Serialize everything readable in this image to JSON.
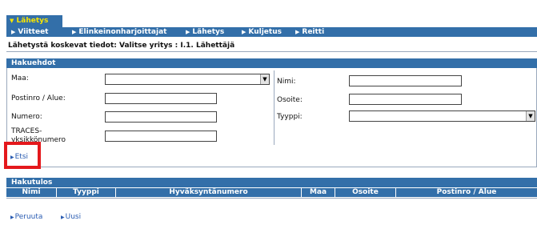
{
  "tabs": {
    "active_label": "Lähetys"
  },
  "nav": {
    "items": [
      {
        "label": "Viitteet"
      },
      {
        "label": "Elinkeinonharjoittajat"
      },
      {
        "label": "Lähetys"
      },
      {
        "label": "Kuljetus"
      },
      {
        "label": "Reitti"
      }
    ]
  },
  "breadcrumb": "Lähetystä koskevat tiedot: Valitse yritys : I.1. Lähettäjä",
  "search": {
    "header": "Hakuehdot",
    "left": {
      "maa_label": "Maa:",
      "maa_value": "",
      "postinro_label": "Postinro / Alue:",
      "postinro_value": "",
      "numero_label": "Numero:",
      "numero_value": "",
      "traces_label": "TRACES-yksikkönumero",
      "traces_value": ""
    },
    "right": {
      "nimi_label": "Nimi:",
      "nimi_value": "",
      "osoite_label": "Osoite:",
      "osoite_value": "",
      "tyyppi_label": "Tyyppi:",
      "tyyppi_value": ""
    },
    "etsi_label": "Etsi"
  },
  "results": {
    "header": "Hakutulos",
    "columns": [
      "Nimi",
      "Tyyppi",
      "Hyväksyntänumero",
      "Maa",
      "Osoite",
      "Postinro / Alue"
    ]
  },
  "footer": {
    "cancel_label": "Peruuta",
    "new_label": "Uusi"
  },
  "colors": {
    "bar": "#336fa9",
    "active_tab_text": "#f7e400",
    "link": "#2a5cb2",
    "highlight": "#e4181c"
  }
}
